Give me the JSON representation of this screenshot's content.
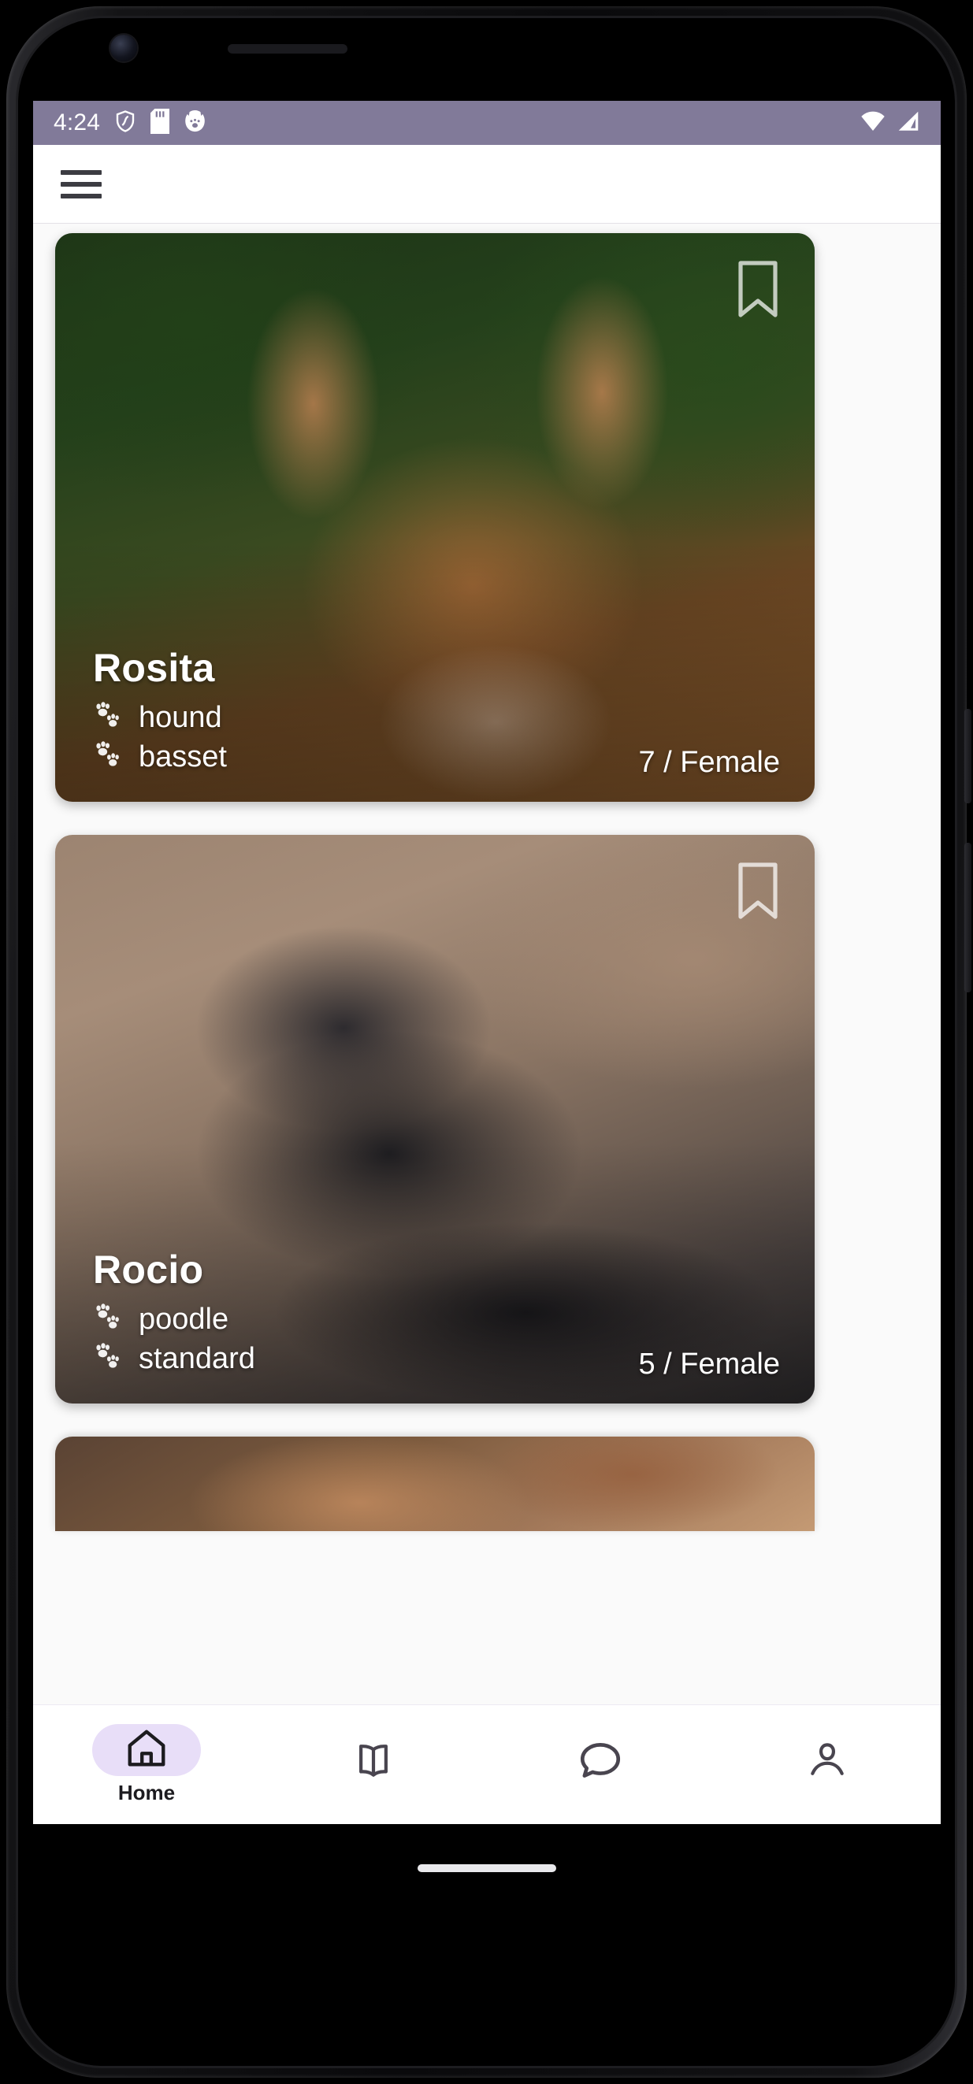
{
  "status_bar": {
    "time": "4:24",
    "left_icons": [
      "shield-icon",
      "sd-card-icon",
      "pet-face-icon"
    ],
    "right_icons": [
      "wifi-icon",
      "cellular-signal-icon"
    ],
    "background_color": "#817A99"
  },
  "app_bar": {
    "menu_icon": "hamburger-menu-icon",
    "background_color": "#FFFFFF"
  },
  "cards": [
    {
      "name": "Rosita",
      "breed_primary": "hound",
      "breed_secondary": "basset",
      "meta": "7 / Female",
      "age": "7",
      "gender": "Female",
      "bookmark_icon": "bookmark-outline-icon",
      "breed_icon": "paw-prints-icon",
      "photo_alt": "brown and white hound dog with large ears in green foliage"
    },
    {
      "name": "Rocio",
      "breed_primary": "poodle",
      "breed_secondary": "standard",
      "meta": "5 / Female",
      "age": "5",
      "gender": "Female",
      "bookmark_icon": "bookmark-outline-icon",
      "breed_icon": "paw-prints-icon",
      "photo_alt": "black standard poodle lying on sandy ground"
    }
  ],
  "bottom_nav": {
    "items": [
      {
        "label": "Home",
        "icon": "home-icon",
        "active": true
      },
      {
        "label": "",
        "icon": "book-icon",
        "active": false
      },
      {
        "label": "",
        "icon": "chat-bubble-icon",
        "active": false
      },
      {
        "label": "",
        "icon": "person-icon",
        "active": false
      }
    ],
    "active_pill_color": "#E8DEF8"
  }
}
